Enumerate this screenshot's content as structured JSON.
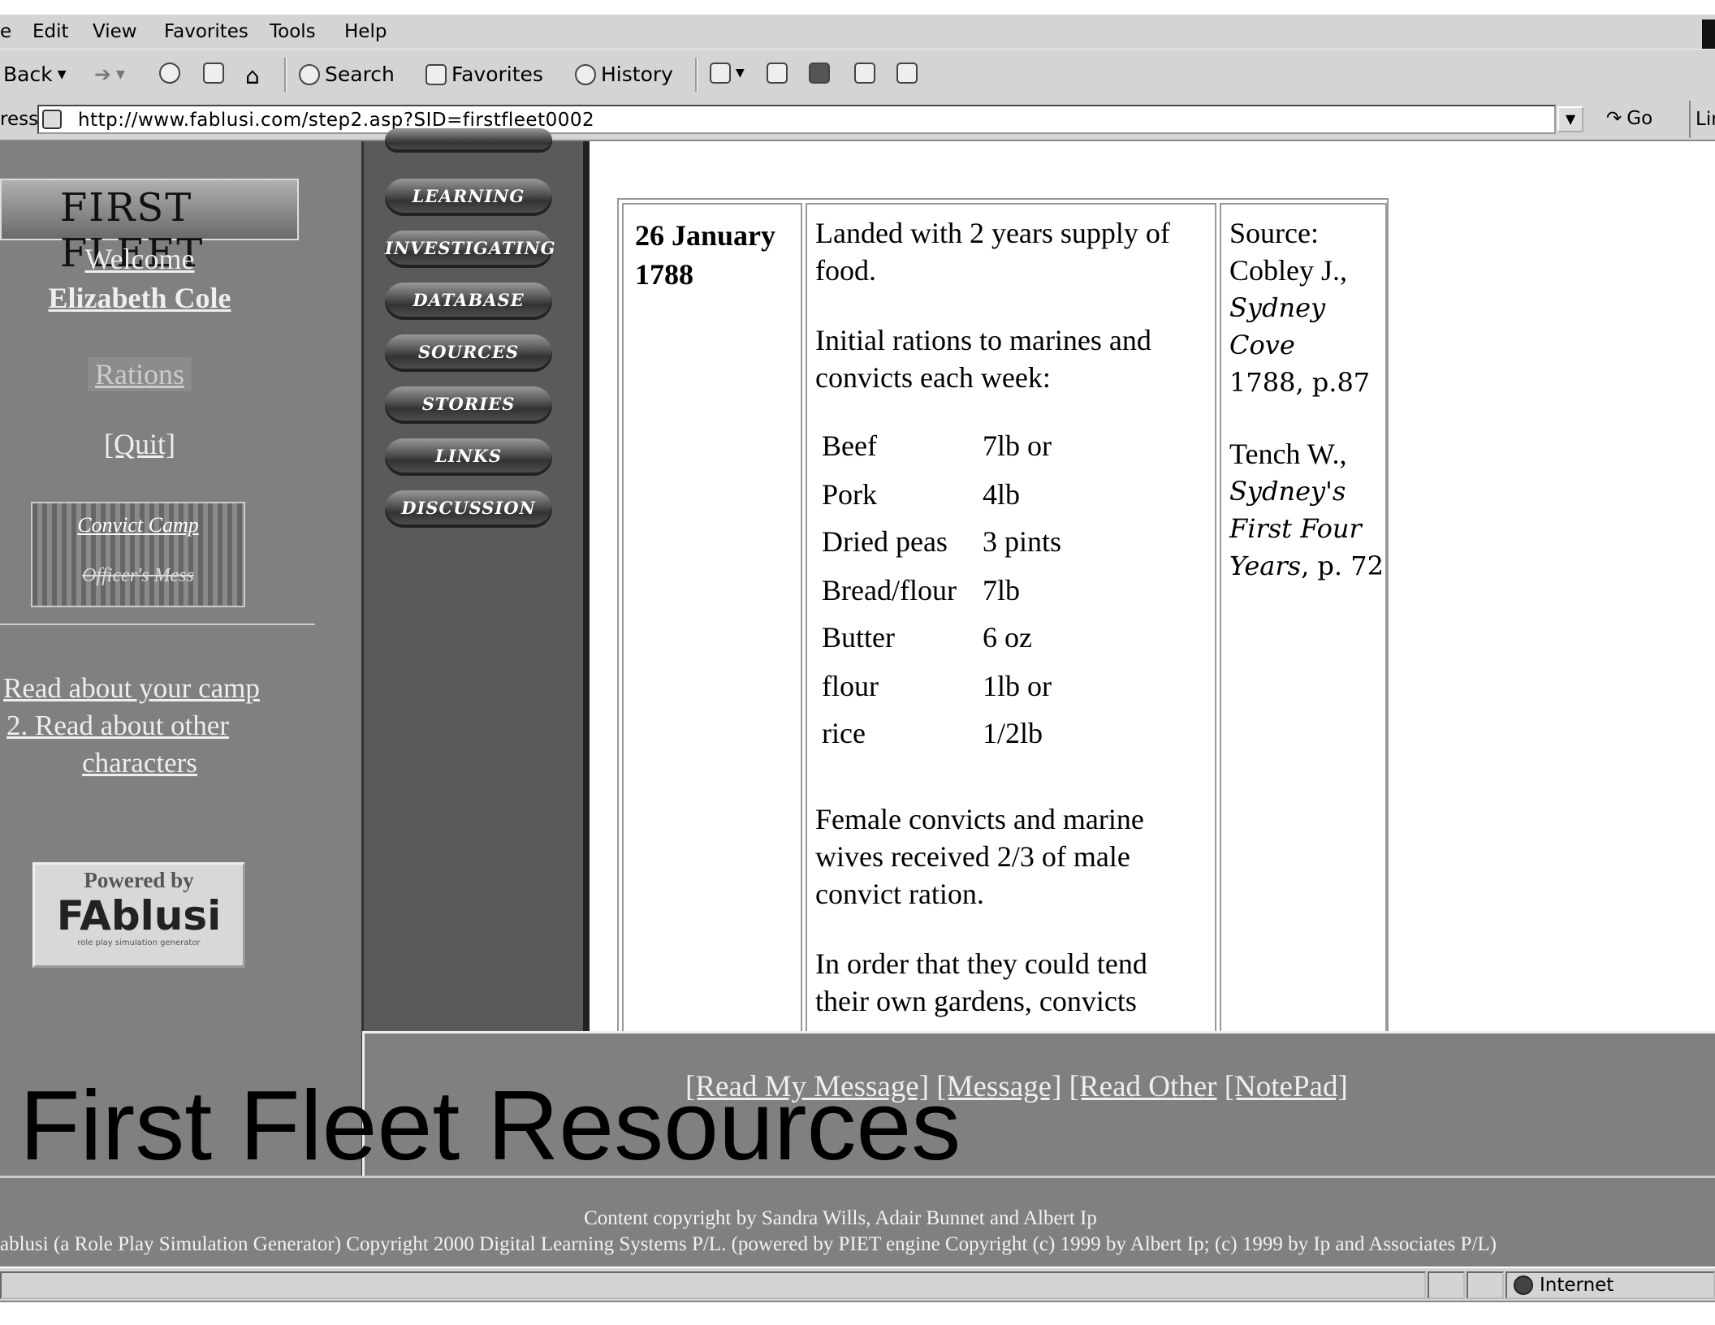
{
  "browser": {
    "menu": [
      "e",
      "Edit",
      "View",
      "Favorites",
      "Tools",
      "Help"
    ],
    "toolbar": {
      "back": "Back",
      "search": "Search",
      "favorites": "Favorites",
      "history": "History"
    },
    "address": {
      "label": "ress",
      "url": "http://www.fablusi.com/step2.asp?SID=firstfleet0002",
      "go": "Go",
      "links": "Lin"
    },
    "status": {
      "zone": "Internet"
    }
  },
  "sidebar": {
    "logo": "FIRST FLEET",
    "welcome": "Welcome",
    "user": "Elizabeth Cole",
    "rations": "Rations",
    "quit": "[Quit]",
    "convict_camp": "Convict Camp",
    "officers_mess": "Officer's Mess",
    "read_camp": "Read about your camp",
    "read_other": "2. Read about other",
    "characters": "characters",
    "powered_by": "Powered by",
    "brand": "FAblusi",
    "brand_sub": "role play simulation generator"
  },
  "nav": [
    "LEARNING",
    "INVESTIGATING",
    "DATABASE",
    "SOURCES",
    "STORIES",
    "LINKS",
    "DISCUSSION"
  ],
  "record": {
    "date": "26 January 1788",
    "landed": "Landed with 2 years supply of food.",
    "initial": "Initial rations to marines and convicts each week:",
    "rations": [
      {
        "item": "Beef",
        "amount": "7lb or"
      },
      {
        "item": "Pork",
        "amount": "4lb"
      },
      {
        "item": "Dried peas",
        "amount": "3 pints"
      },
      {
        "item": "Bread/flour",
        "amount": "7lb"
      },
      {
        "item": "Butter",
        "amount": "6 oz"
      },
      {
        "item": "flour",
        "amount": "1lb or"
      },
      {
        "item": "rice",
        "amount": "1/2lb"
      }
    ],
    "female": "Female convicts and marine wives received 2/3 of male convict ration.",
    "order": "In order that they could tend their own gardens, convicts",
    "source": {
      "s1_label": "Source:",
      "s1_author": "Cobley J.,",
      "s1_title": "Sydney Cove",
      "s1_detail": "1788, p.87",
      "s2_author": "Tench W.,",
      "s2_title": "Sydney's First Four Years",
      "s2_detail": ", p. 72"
    }
  },
  "messages": {
    "read_my": "[Read My Message]",
    "message": "[Message]",
    "read_other": "[Read Other",
    "notepad": "[NotePad]"
  },
  "overlay_title": "First Fleet Resources",
  "footer": {
    "line1": "Content copyright by Sandra Wills, Adair Bunnet and Albert Ip",
    "line2": "ablusi (a Role Play Simulation Generator) Copyright 2000 Digital Learning Systems P/L. (powered by PIET engine Copyright (c) 1999 by Albert Ip; (c) 1999 by Ip and Associates P/L)"
  }
}
